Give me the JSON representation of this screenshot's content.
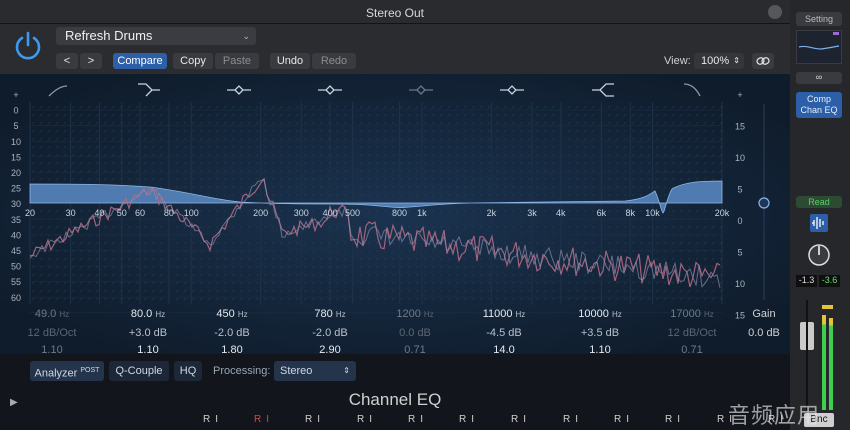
{
  "window": {
    "title": "Stereo Out"
  },
  "toolbar": {
    "preset": "Refresh Drums",
    "compare": "Compare",
    "copy": "Copy",
    "paste": "Paste",
    "undo": "Undo",
    "redo": "Redo",
    "view_label": "View:",
    "view_value": "100%",
    "prev": "<",
    "next": ">"
  },
  "eq": {
    "left_db_scale": [
      "+",
      "0",
      "5",
      "10",
      "15",
      "20",
      "25",
      "30",
      "35",
      "40",
      "45",
      "50",
      "55",
      "60"
    ],
    "right_db_scale": [
      "+",
      "15",
      "10",
      "5",
      "0",
      "5",
      "10",
      "15"
    ],
    "freq_labels": [
      "20",
      "30",
      "40",
      "50",
      "60",
      "80",
      "100",
      "200",
      "300",
      "400",
      "500",
      "800",
      "1k",
      "2k",
      "3k",
      "4k",
      "6k",
      "8k",
      "10k",
      "20k"
    ],
    "gain_label": "Gain",
    "gain_value": "0.0 dB",
    "bands": [
      {
        "freq": "49.0",
        "unit": "Hz",
        "gain": "12 dB/Oct",
        "q": "1.10",
        "active": false
      },
      {
        "freq": "80.0",
        "unit": "Hz",
        "gain": "+3.0 dB",
        "q": "1.10",
        "active": true
      },
      {
        "freq": "450",
        "unit": "Hz",
        "gain": "-2.0 dB",
        "q": "1.80",
        "active": true
      },
      {
        "freq": "780",
        "unit": "Hz",
        "gain": "-2.0 dB",
        "q": "2.90",
        "active": true
      },
      {
        "freq": "1200",
        "unit": "Hz",
        "gain": "0.0 dB",
        "q": "0.71",
        "active": false
      },
      {
        "freq": "11000",
        "unit": "Hz",
        "gain": "-4.5 dB",
        "q": "14.0",
        "active": true
      },
      {
        "freq": "10000",
        "unit": "Hz",
        "gain": "+3.5 dB",
        "q": "1.10",
        "active": true
      },
      {
        "freq": "17000",
        "unit": "Hz",
        "gain": "12 dB/Oct",
        "q": "0.71",
        "active": false
      }
    ]
  },
  "bottom": {
    "analyzer": "Analyzer",
    "analyzer_sup": "POST",
    "qcouple": "Q-Couple",
    "hq": "HQ",
    "processing_label": "Processing:",
    "processing_value": "Stereo",
    "channel_name": "Channel EQ"
  },
  "strip": {
    "setting": "Setting",
    "plugin_line1": "Comp",
    "plugin_line2": "Chan EQ",
    "read": "Read",
    "level_left": "-1.3",
    "level_right": "-3.6",
    "bnc": "Bnc"
  },
  "mixer_buttons": [
    "R",
    "I",
    "R",
    "I",
    "R",
    "I",
    "R",
    "I",
    "R",
    "I",
    "R",
    "I",
    "R",
    "I",
    "R",
    "I",
    "R",
    "I",
    "R",
    "I",
    "R",
    "I",
    "R",
    "I"
  ],
  "watermark": "音频应用",
  "colors": {
    "accent": "#3b7fd9",
    "curve_fill": "#5f8fc8",
    "analyzer": "#b06a86",
    "read": "#5ccf6a"
  }
}
